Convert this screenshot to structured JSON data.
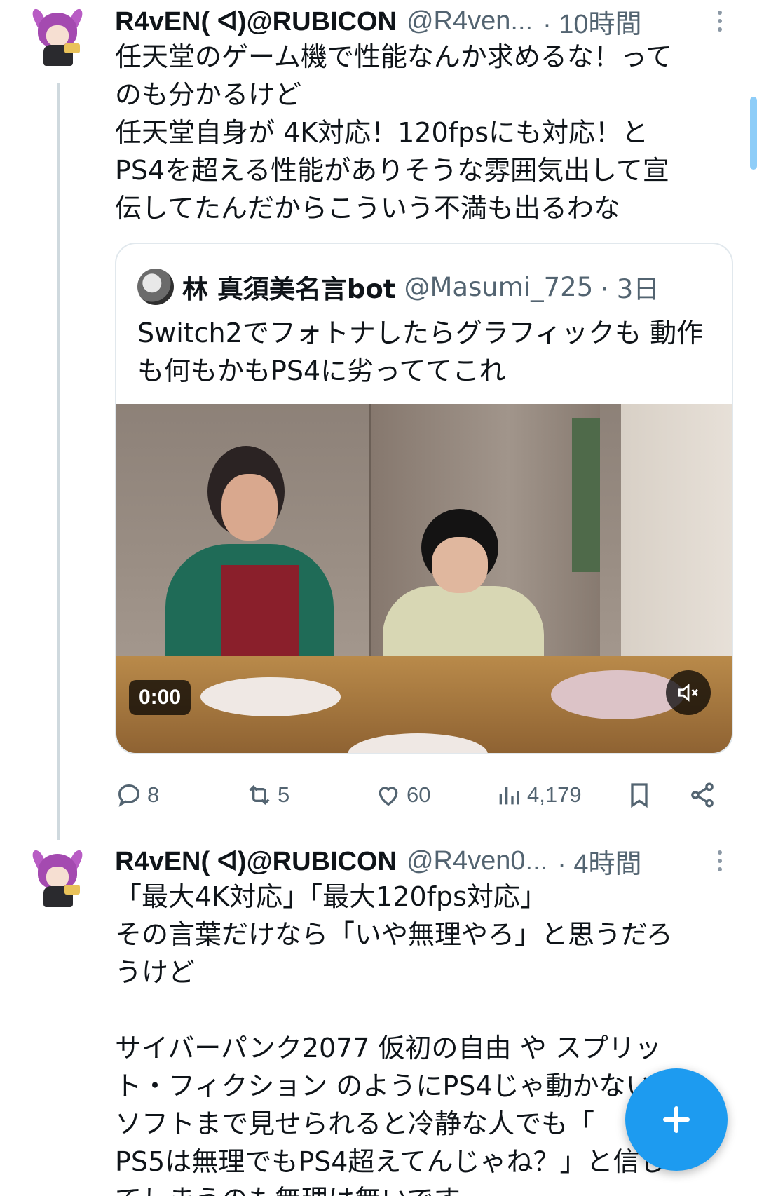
{
  "tweets": [
    {
      "author_name": "R4vEN( ᐊ)@RUBICON",
      "author_handle": "@R4ven...",
      "time": "· 10時間",
      "text": "任天堂のゲーム機で性能なんか求めるな！って\nのも分かるけど\n任天堂自身が 4K対応！120fpsにも対応！と\nPS4を超える性能がありそうな雰囲気出して宣\n伝してたんだからこういう不満も出るわな",
      "quote": {
        "author_name": "林 真須美名言bot",
        "author_handle": "@Masumi_725",
        "time": "· 3日",
        "text": "Switch2でフォトナしたらグラフィックも\n動作も何もかもPS4に劣っててこれ",
        "video_time": "0:00"
      },
      "actions": {
        "replies": "8",
        "retweets": "5",
        "likes": "60",
        "views": "4,179"
      }
    },
    {
      "author_name": "R4vEN( ᐊ)@RUBICON",
      "author_handle": "@R4ven0...",
      "time": "· 4時間",
      "text": "「最大4K対応」「最大120fps対応」\nその言葉だけなら「いや無理やろ」と思うだろ\nうけど\n\nサイバーパンク2077 仮初の自由 や スプリッ\nト・フィクション のようにPS4じゃ動かない\nソフトまで見せられると冷静な人でも「\nPS5は無理でもPS4超えてんじゃね？」と信じ\nてしまうのも無理は無いです"
    }
  ],
  "icons": {
    "reply": "reply-icon",
    "retweet": "retweet-icon",
    "like": "heart-icon",
    "views": "views-icon",
    "bookmark": "bookmark-icon",
    "share": "share-icon",
    "mute": "mute-icon",
    "compose": "plus-icon"
  },
  "colors": {
    "accent": "#1d9bf0",
    "text": "#0f1419",
    "secondary": "#536471"
  }
}
